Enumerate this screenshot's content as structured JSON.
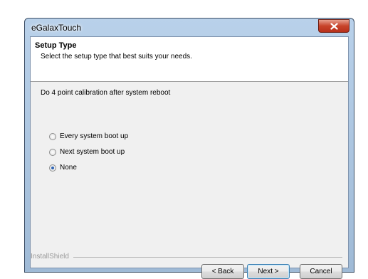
{
  "window": {
    "title": "eGalaxTouch"
  },
  "header": {
    "title": "Setup Type",
    "subtitle": "Select the setup type that best suits your needs."
  },
  "instruction": "Do 4 point calibration after system reboot",
  "options": [
    {
      "label": "Every system boot up",
      "checked": false
    },
    {
      "label": "Next system boot up",
      "checked": false
    },
    {
      "label": "None",
      "checked": true
    }
  ],
  "brand": "InstallShield",
  "buttons": {
    "back": "< Back",
    "next": "Next >",
    "cancel": "Cancel"
  },
  "icons": {
    "close": "close-icon"
  }
}
